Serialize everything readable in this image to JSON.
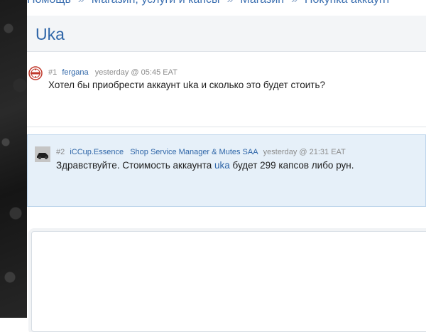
{
  "breadcrumb": {
    "items": [
      "Помощь",
      "Магазин, услуги и капсы",
      "Магазин",
      "Покупка аккаунт"
    ],
    "separator": "»"
  },
  "thread": {
    "title": "Uka"
  },
  "posts": [
    {
      "number": "#1",
      "author": "fergana",
      "role": "",
      "time": "yesterday @ 05:45 EAT",
      "text_before": "Хотел бы приобрести аккаунт uka и сколько это будет стоить?",
      "link": "",
      "text_after": ""
    },
    {
      "number": "#2",
      "author": "iCCup.Essence",
      "role": "Shop Service Manager & Mutes SAA",
      "time": "yesterday @ 21:31 EAT",
      "text_before": "Здравствуйте. Стоимость аккаунта ",
      "link": "uka",
      "text_after": " будет 299 капсов либо рун."
    }
  ],
  "colors": {
    "accent": "#2f66a8",
    "highlight_post_bg": "#e6f0f9",
    "highlight_post_border": "#bfd6ec"
  },
  "icons": {
    "avatar1": "badge-avatar-icon",
    "avatar2": "car-avatar-icon"
  }
}
